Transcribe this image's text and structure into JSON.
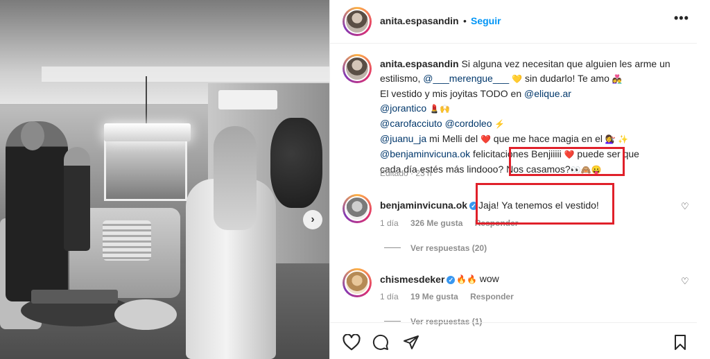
{
  "post": {
    "username": "anita.espasandin",
    "follow_label": "Seguir",
    "more_label": "•••",
    "separator": "•"
  },
  "caption": {
    "username": "anita.espasandin",
    "line1_text": " Si alguna vez necesitan que alguien les arme un",
    "line2_pre": "estilismo, ",
    "line2_mention": "@___merengue___",
    "line2_emoji": "💛",
    "line2_post": " sin dudarlo! Te amo ",
    "line2_emoji2": "👩‍❤️‍👨",
    "line3_pre": "El vestido y mis joyitas TODO en ",
    "line3_mention": "@elique.ar",
    "line4_mention": "@jorantico",
    "line4_emoji": "💄🙌",
    "line5_mention1": "@carofacciuto",
    "line5_mention2": "@cordoleo",
    "line5_emoji": "⚡",
    "line6_mention": "@juanu_ja",
    "line6_text1": " mi Melli del ",
    "line6_heart": "❤️",
    "line6_text2": " que me hace magia en el ",
    "line6_emoji": "💇‍♀️ ✨",
    "line7_mention": "@benjaminvicuna.ok",
    "line7_text": " felicitaciones Benjiiiii ",
    "line7_heart": "❤️",
    "line7_text2": " puede ser que",
    "line8_text": "cada día estés más lindooo? Nos casamos?",
    "line8_emoji": "👀🙈😛",
    "meta": "Editado · 23 h"
  },
  "comments": [
    {
      "username": "benjaminvicuna.ok",
      "verified": "✓",
      "text": "Jaja! Ya tenemos el vestido!",
      "time": "1 día",
      "likes": "326 Me gusta",
      "reply": "Responder",
      "view_replies": "Ver respuestas (20)"
    },
    {
      "username": "chismesdeker",
      "verified": "✓",
      "emoji": "🔥🔥",
      "text": "wow",
      "time": "1 día",
      "likes": "19 Me gusta",
      "reply": "Responder",
      "view_replies": "Ver respuestas (1)"
    }
  ],
  "icons": {
    "carousel_next": "›",
    "heart_small": "♡"
  },
  "colors": {
    "link": "#00376b",
    "follow": "#0095f6",
    "highlight_box": "#e0202a",
    "verified": "#3897f0"
  }
}
